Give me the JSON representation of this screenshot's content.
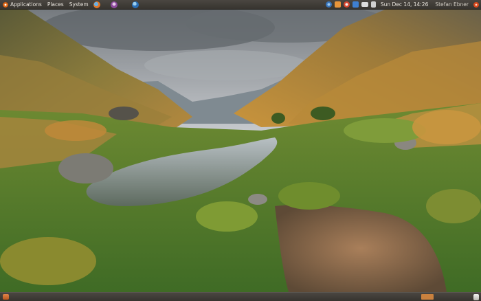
{
  "top_panel": {
    "menus": [
      {
        "label": "Applications",
        "icon": "ubuntu-logo-icon"
      },
      {
        "label": "Places"
      },
      {
        "label": "System"
      }
    ],
    "launchers": [
      "firefox-icon",
      "messenger-icon",
      "web-browser-icon"
    ],
    "tray_icons": [
      "network-icon",
      "settings-icon",
      "update-icon",
      "bluetooth-icon",
      "mail-icon",
      "volume-icon"
    ],
    "clock": "Sun Dec 14, 14:26",
    "user": "Stefan Ebner",
    "shutdown_icon": "power-icon"
  },
  "desktop": {
    "wallpaper": "mountain-valley-stream"
  },
  "bottom_panel": {
    "left_icon": "show-desktop-icon",
    "right_icons": [
      "workspace-switcher-icon",
      "trash-icon"
    ]
  },
  "colors": {
    "panel": "#3f3b36",
    "accent_orange": "#e06c1b"
  }
}
